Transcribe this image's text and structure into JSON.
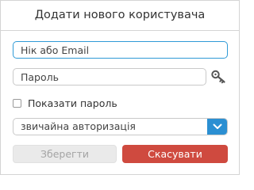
{
  "dialog": {
    "title": "Додати нового користувача"
  },
  "form": {
    "login": {
      "placeholder": "Нік або Email",
      "value": ""
    },
    "password": {
      "placeholder": "Пароль",
      "value": ""
    },
    "password_key_icon": "key-icon",
    "show_password": {
      "label": "Показати пароль",
      "checked": false
    },
    "auth_select": {
      "selected": "звичайна авторизація",
      "arrow_icon": "chevron-down-icon"
    }
  },
  "buttons": {
    "save_label": "Зберегти",
    "cancel_label": "Скасувати"
  },
  "colors": {
    "focus_border": "#2f9ad6",
    "select_arrow_bg": "#2b8fd2",
    "cancel_bg": "#cf4a3f",
    "save_disabled_bg": "#eaeaea"
  }
}
